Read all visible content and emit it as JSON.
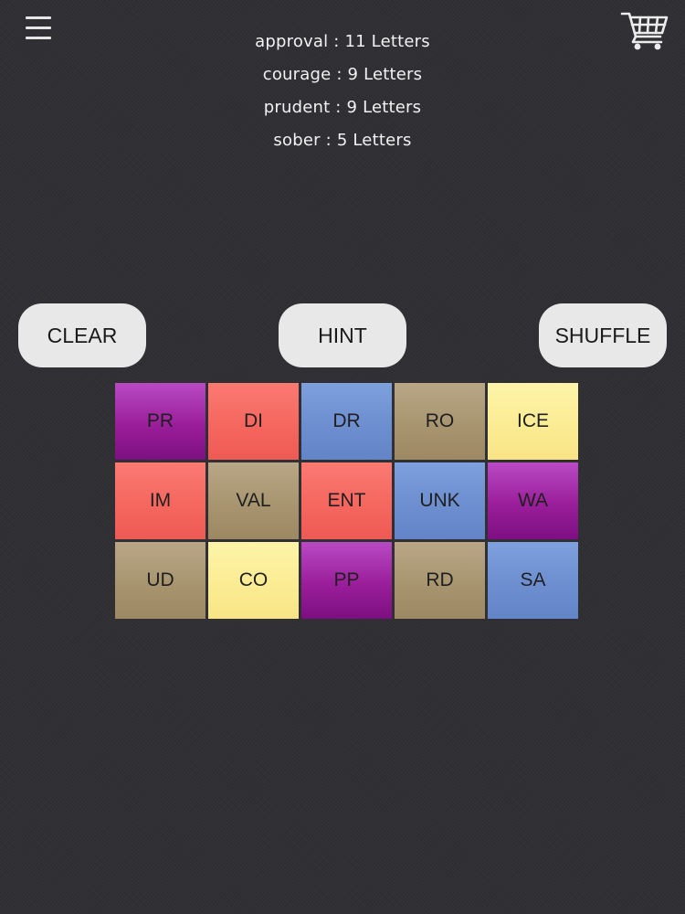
{
  "header": {
    "menu_icon": "hamburger-menu-icon",
    "cart_icon": "shopping-cart-icon"
  },
  "clues": [
    {
      "text": "approval : 11 Letters"
    },
    {
      "text": "courage : 9 Letters"
    },
    {
      "text": "prudent : 9 Letters"
    },
    {
      "text": "sober : 5 Letters"
    }
  ],
  "buttons": {
    "clear": "CLEAR",
    "hint": "HINT",
    "shuffle": "SHUFFLE"
  },
  "tiles": [
    {
      "label": "PR",
      "color": "purple"
    },
    {
      "label": "DI",
      "color": "coral"
    },
    {
      "label": "DR",
      "color": "blue"
    },
    {
      "label": "RO",
      "color": "tan"
    },
    {
      "label": "ICE",
      "color": "yellow"
    },
    {
      "label": "IM",
      "color": "coral"
    },
    {
      "label": "VAL",
      "color": "tan"
    },
    {
      "label": "ENT",
      "color": "coral"
    },
    {
      "label": "UNK",
      "color": "blue"
    },
    {
      "label": "WA",
      "color": "purple"
    },
    {
      "label": "UD",
      "color": "tan"
    },
    {
      "label": "CO",
      "color": "yellow"
    },
    {
      "label": "PP",
      "color": "purple"
    },
    {
      "label": "RD",
      "color": "tan"
    },
    {
      "label": "SA",
      "color": "blue"
    }
  ],
  "palette": {
    "background": "#2f2f34",
    "purple": "#9a1e9a",
    "coral": "#f4675f",
    "blue": "#6d8ecf",
    "tan": "#a89570",
    "yellow": "#fbec94",
    "button": "#e8e8e8"
  }
}
